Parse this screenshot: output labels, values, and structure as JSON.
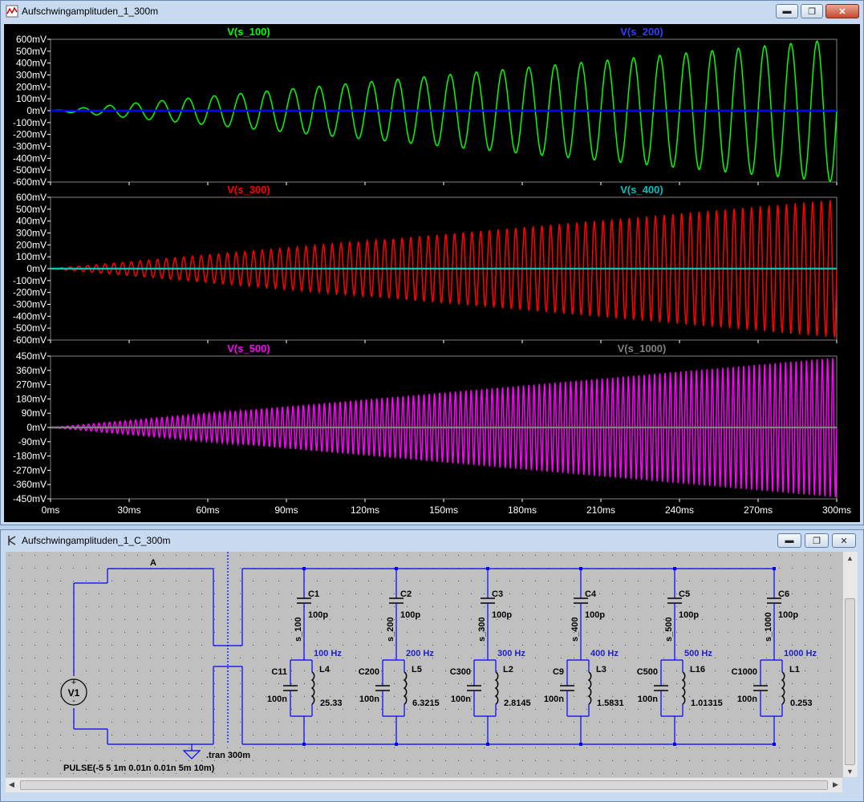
{
  "waveform_window": {
    "title": "Aufschwingamplituden_1_300m",
    "buttons": {
      "minimize": "▬",
      "restore": "❐",
      "close": "✕"
    }
  },
  "schematic_window": {
    "title": "Aufschwingamplituden_1_C_300m",
    "buttons": {
      "minimize": "▬",
      "restore": "❐",
      "close": "✕"
    }
  },
  "chart_data": [
    {
      "type": "line",
      "pane": "top",
      "series": [
        {
          "name": "V(s_100)",
          "color": "#00ff00",
          "frequency_hz": 100,
          "amplitude_envelope_mv": [
            [
              0,
              0
            ],
            [
              300,
              600
            ]
          ]
        },
        {
          "name": "V(s_200)",
          "color": "#0000ff",
          "frequency_hz": 200,
          "amplitude_envelope_mv": [
            [
              0,
              0
            ],
            [
              300,
              0
            ]
          ]
        }
      ],
      "x_ticks": [
        "0ms",
        "30ms",
        "60ms",
        "90ms",
        "120ms",
        "150ms",
        "180ms",
        "210ms",
        "240ms",
        "270ms",
        "300ms"
      ],
      "y_ticks": [
        "600mV",
        "500mV",
        "400mV",
        "300mV",
        "200mV",
        "100mV",
        "0mV",
        "-100mV",
        "-200mV",
        "-300mV",
        "-400mV",
        "-500mV",
        "-600mV"
      ],
      "xlim": [
        0,
        300
      ],
      "ylim": [
        -600,
        600
      ]
    },
    {
      "type": "line",
      "pane": "middle",
      "series": [
        {
          "name": "V(s_300)",
          "color": "#ff0000",
          "frequency_hz": 300,
          "amplitude_envelope_mv": [
            [
              0,
              0
            ],
            [
              300,
              580
            ]
          ]
        },
        {
          "name": "V(s_400)",
          "color": "#00c0c0",
          "frequency_hz": 400,
          "amplitude_envelope_mv": [
            [
              0,
              0
            ],
            [
              300,
              0
            ]
          ]
        }
      ],
      "x_ticks": [
        "0ms",
        "30ms",
        "60ms",
        "90ms",
        "120ms",
        "150ms",
        "180ms",
        "210ms",
        "240ms",
        "270ms",
        "300ms"
      ],
      "y_ticks": [
        "600mV",
        "500mV",
        "400mV",
        "300mV",
        "200mV",
        "100mV",
        "0mV",
        "-100mV",
        "-200mV",
        "-300mV",
        "-400mV",
        "-500mV",
        "-600mV"
      ],
      "xlim": [
        0,
        300
      ],
      "ylim": [
        -600,
        600
      ]
    },
    {
      "type": "line",
      "pane": "bottom",
      "series": [
        {
          "name": "V(s_500)",
          "color": "#ff00ff",
          "frequency_hz": 500,
          "amplitude_envelope_mv": [
            [
              0,
              0
            ],
            [
              300,
              440
            ]
          ]
        },
        {
          "name": "V(s_1000)",
          "color": "#808080",
          "frequency_hz": 1000,
          "amplitude_envelope_mv": [
            [
              0,
              0
            ],
            [
              300,
              0
            ]
          ]
        }
      ],
      "x_ticks": [
        "0ms",
        "30ms",
        "60ms",
        "90ms",
        "120ms",
        "150ms",
        "180ms",
        "210ms",
        "240ms",
        "270ms",
        "300ms"
      ],
      "y_ticks": [
        "450mV",
        "360mV",
        "270mV",
        "180mV",
        "90mV",
        "0mV",
        "-90mV",
        "-180mV",
        "-270mV",
        "-360mV",
        "-450mV"
      ],
      "xlim": [
        0,
        300
      ],
      "ylim": [
        -450,
        450
      ]
    }
  ],
  "schematic": {
    "net_a": "A",
    "source": {
      "name": "V1",
      "value": "PULSE(-5 5 1m 0.01n 0.01n 5m 10m)"
    },
    "directive": ".tran 300m",
    "branches": [
      {
        "cap_series": "C1",
        "cap_series_val": "100p",
        "node": "s_100",
        "freq": "100 Hz",
        "cap_par": "C11",
        "cap_par_val": "100n",
        "ind": "L4",
        "ind_val": "25.33"
      },
      {
        "cap_series": "C2",
        "cap_series_val": "100p",
        "node": "s_200",
        "freq": "200 Hz",
        "cap_par": "C200",
        "cap_par_val": "100n",
        "ind": "L5",
        "ind_val": "6.3215"
      },
      {
        "cap_series": "C3",
        "cap_series_val": "100p",
        "node": "s_300",
        "freq": "300 Hz",
        "cap_par": "C300",
        "cap_par_val": "100n",
        "ind": "L2",
        "ind_val": "2.8145"
      },
      {
        "cap_series": "C4",
        "cap_series_val": "100p",
        "node": "s_400",
        "freq": "400 Hz",
        "cap_par": "C9",
        "cap_par_val": "100n",
        "ind": "L3",
        "ind_val": "1.5831"
      },
      {
        "cap_series": "C5",
        "cap_series_val": "100p",
        "node": "s_500",
        "freq": "500 Hz",
        "cap_par": "C500",
        "cap_par_val": "100n",
        "ind": "L16",
        "ind_val": "1.01315"
      },
      {
        "cap_series": "C6",
        "cap_series_val": "100p",
        "node": "s_1000",
        "freq": "1000 Hz",
        "cap_par": "C1000",
        "cap_par_val": "100n",
        "ind": "L1",
        "ind_val": "0.253"
      }
    ]
  }
}
